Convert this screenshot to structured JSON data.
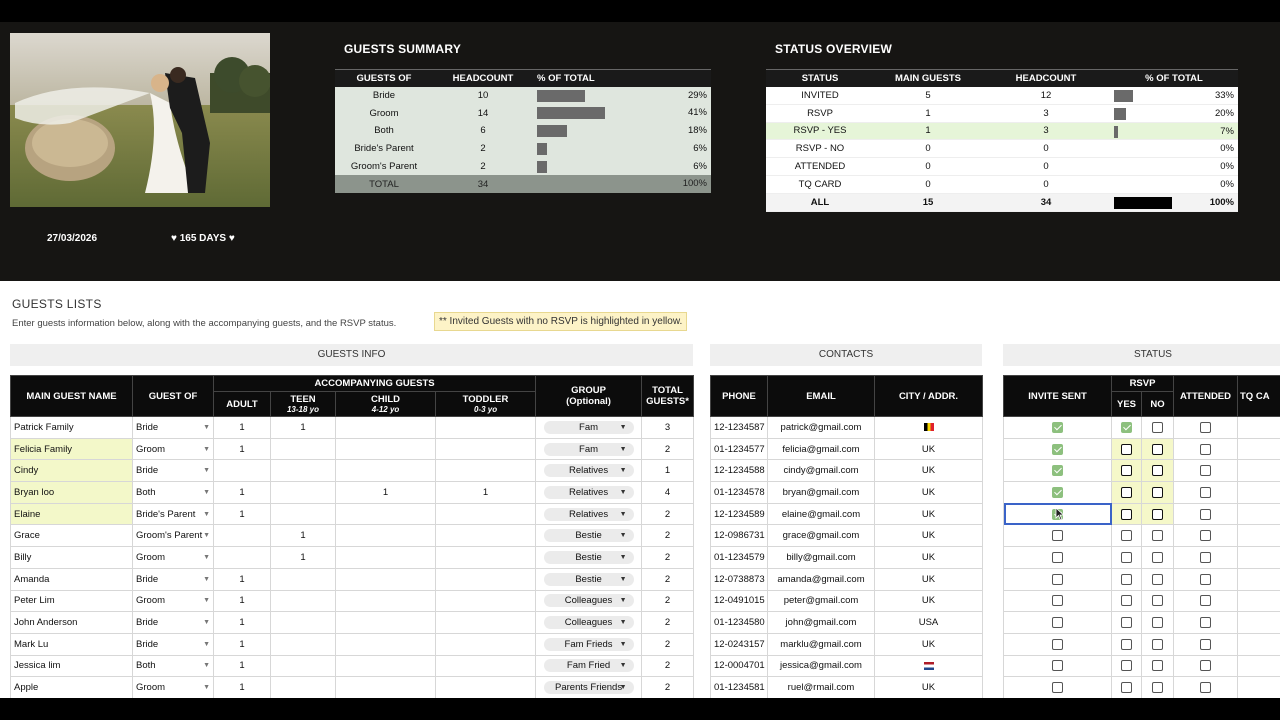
{
  "header": {
    "date": "27/03/2026",
    "days": "♥ 165 DAYS ♥"
  },
  "guests_summary": {
    "title": "GUESTS SUMMARY",
    "columns": [
      "GUESTS OF",
      "HEADCOUNT",
      "% OF TOTAL"
    ],
    "rows": [
      {
        "of": "Bride",
        "count": "10",
        "pct": "29%",
        "frac": 0.29
      },
      {
        "of": "Groom",
        "count": "14",
        "pct": "41%",
        "frac": 0.41
      },
      {
        "of": "Both",
        "count": "6",
        "pct": "18%",
        "frac": 0.18
      },
      {
        "of": "Bride's Parent",
        "count": "2",
        "pct": "6%",
        "frac": 0.06
      },
      {
        "of": "Groom's Parent",
        "count": "2",
        "pct": "6%",
        "frac": 0.06
      }
    ],
    "total": {
      "label": "TOTAL",
      "count": "34",
      "pct": "100%"
    }
  },
  "status_overview": {
    "title": "STATUS OVERVIEW",
    "columns": [
      "STATUS",
      "MAIN GUESTS",
      "HEADCOUNT",
      "% OF TOTAL"
    ],
    "rows": [
      {
        "status": "INVITED",
        "main": "5",
        "count": "12",
        "pct": "33%",
        "frac": 0.33
      },
      {
        "status": "RSVP",
        "main": "1",
        "count": "3",
        "pct": "20%",
        "frac": 0.2
      },
      {
        "status": "RSVP - YES",
        "main": "1",
        "count": "3",
        "pct": "7%",
        "frac": 0.07
      },
      {
        "status": "RSVP - NO",
        "main": "0",
        "count": "0",
        "pct": "0%",
        "frac": 0
      },
      {
        "status": "ATTENDED",
        "main": "0",
        "count": "0",
        "pct": "0%",
        "frac": 0
      },
      {
        "status": "TQ CARD",
        "main": "0",
        "count": "0",
        "pct": "0%",
        "frac": 0
      }
    ],
    "total": {
      "status": "ALL",
      "main": "15",
      "count": "34",
      "pct": "100%",
      "frac": 1
    }
  },
  "guests_lists": {
    "title": "GUESTS LISTS",
    "subtitle": "Enter guests information below, along with the accompanying guests, and the RSVP status.",
    "note": "** Invited Guests with no RSVP is highlighted in yellow.",
    "groups": {
      "info": "GUESTS INFO",
      "contacts": "CONTACTS",
      "status": "STATUS"
    },
    "headers": {
      "name": "MAIN GUEST NAME",
      "guest_of": "GUEST OF",
      "accompanying": "ACCOMPANYING GUESTS",
      "adult": "ADULT",
      "teen": "TEEN",
      "teen_sub": "13-18 yo",
      "child": "CHILD",
      "child_sub": "4-12 yo",
      "toddler": "TODDLER",
      "toddler_sub": "0-3 yo",
      "group": "GROUP",
      "group_sub": "(Optional)",
      "total": "TOTAL",
      "total_sub": "GUESTS*",
      "phone": "PHONE",
      "email": "EMAIL",
      "city": "CITY / ADDR.",
      "invite": "INVITE SENT",
      "rsvp": "RSVP",
      "yes": "YES",
      "no": "NO",
      "attended": "ATTENDED",
      "tq": "TQ CA"
    },
    "rows": [
      {
        "name": "Patrick Family",
        "of": "Bride",
        "adult": "1",
        "teen": "1",
        "child": "",
        "toddler": "",
        "group": "Fam",
        "total": "3",
        "phone": "12-1234587",
        "email": "patrick@gmail.com",
        "city": "",
        "flag": "be",
        "invite": true,
        "yes": true,
        "no": false,
        "yellow": false
      },
      {
        "name": "Felicia Family",
        "of": "Groom",
        "adult": "1",
        "teen": "",
        "child": "",
        "toddler": "",
        "group": "Fam",
        "total": "2",
        "phone": "01-1234577",
        "email": "felicia@gmail.com",
        "city": "UK",
        "flag": "",
        "invite": true,
        "yes": false,
        "no": false,
        "yellow": true
      },
      {
        "name": "Cindy",
        "of": "Bride",
        "adult": "",
        "teen": "",
        "child": "",
        "toddler": "",
        "group": "Relatives",
        "total": "1",
        "phone": "12-1234588",
        "email": "cindy@gmail.com",
        "city": "UK",
        "flag": "",
        "invite": true,
        "yes": false,
        "no": false,
        "yellow": true
      },
      {
        "name": "Bryan loo",
        "of": "Both",
        "adult": "1",
        "teen": "",
        "child": "1",
        "toddler": "1",
        "group": "Relatives",
        "total": "4",
        "phone": "01-1234578",
        "email": "bryan@gmail.com",
        "city": "UK",
        "flag": "",
        "invite": true,
        "yes": false,
        "no": false,
        "yellow": true
      },
      {
        "name": "Elaine",
        "of": "Bride's Parent",
        "adult": "1",
        "teen": "",
        "child": "",
        "toddler": "",
        "group": "Relatives",
        "total": "2",
        "phone": "12-1234589",
        "email": "elaine@gmail.com",
        "city": "UK",
        "flag": "",
        "invite": true,
        "yes": false,
        "no": false,
        "yellow": true
      },
      {
        "name": "Grace",
        "of": "Groom's Parent",
        "adult": "",
        "teen": "1",
        "child": "",
        "toddler": "",
        "group": "Bestie",
        "total": "2",
        "phone": "12-0986731",
        "email": "grace@gmail.com",
        "city": "UK",
        "flag": "",
        "invite": false,
        "yes": false,
        "no": false,
        "yellow": false
      },
      {
        "name": "Billy",
        "of": "Groom",
        "adult": "",
        "teen": "1",
        "child": "",
        "toddler": "",
        "group": "Bestie",
        "total": "2",
        "phone": "01-1234579",
        "email": "billy@gmail.com",
        "city": "UK",
        "flag": "",
        "invite": false,
        "yes": false,
        "no": false,
        "yellow": false
      },
      {
        "name": "Amanda",
        "of": "Bride",
        "adult": "1",
        "teen": "",
        "child": "",
        "toddler": "",
        "group": "Bestie",
        "total": "2",
        "phone": "12-0738873",
        "email": "amanda@gmail.com",
        "city": "UK",
        "flag": "",
        "invite": false,
        "yes": false,
        "no": false,
        "yellow": false
      },
      {
        "name": "Peter Lim",
        "of": "Groom",
        "adult": "1",
        "teen": "",
        "child": "",
        "toddler": "",
        "group": "Colleagues",
        "total": "2",
        "phone": "12-0491015",
        "email": "peter@gmail.com",
        "city": "UK",
        "flag": "",
        "invite": false,
        "yes": false,
        "no": false,
        "yellow": false
      },
      {
        "name": "John Anderson",
        "of": "Bride",
        "adult": "1",
        "teen": "",
        "child": "",
        "toddler": "",
        "group": "Colleagues",
        "total": "2",
        "phone": "01-1234580",
        "email": "john@gmail.com",
        "city": "USA",
        "flag": "",
        "invite": false,
        "yes": false,
        "no": false,
        "yellow": false
      },
      {
        "name": "Mark Lu",
        "of": "Bride",
        "adult": "1",
        "teen": "",
        "child": "",
        "toddler": "",
        "group": "Fam Frieds",
        "total": "2",
        "phone": "12-0243157",
        "email": "marklu@gmail.com",
        "city": "UK",
        "flag": "",
        "invite": false,
        "yes": false,
        "no": false,
        "yellow": false
      },
      {
        "name": "Jessica lim",
        "of": "Both",
        "adult": "1",
        "teen": "",
        "child": "",
        "toddler": "",
        "group": "Fam Fried",
        "total": "2",
        "phone": "12-0004701",
        "email": "jessica@gmail.com",
        "city": "",
        "flag": "nl",
        "invite": false,
        "yes": false,
        "no": false,
        "yellow": false
      },
      {
        "name": "Apple",
        "of": "Groom",
        "adult": "1",
        "teen": "",
        "child": "",
        "toddler": "",
        "group": "Parents Friends",
        "total": "2",
        "phone": "01-1234581",
        "email": "ruel@rmail.com",
        "city": "UK",
        "flag": "",
        "invite": false,
        "yes": false,
        "no": false,
        "yellow": false
      }
    ]
  },
  "colors": {
    "dark_bg": "#161513",
    "yellow": "#f3f8c9",
    "check_green": "#8dc07e",
    "summary_green": "#dfe6de"
  }
}
